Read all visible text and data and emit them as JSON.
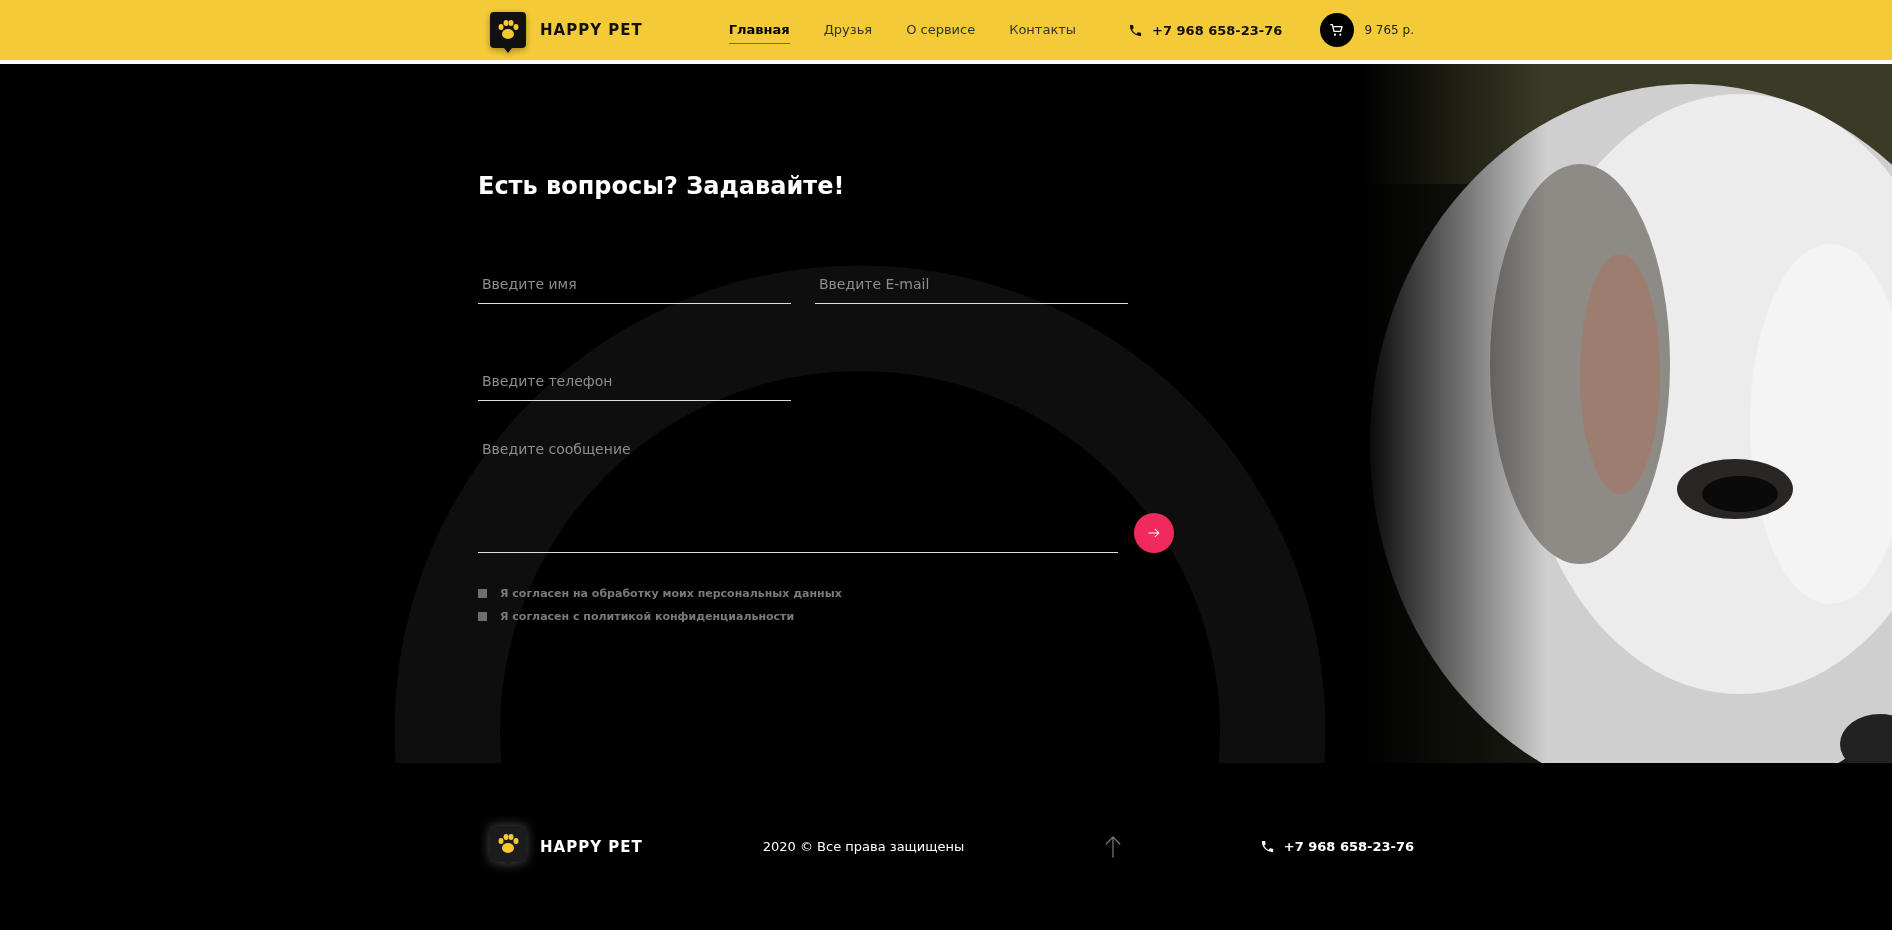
{
  "header": {
    "brand": "HAPPY PET",
    "nav": [
      {
        "label": "Главная",
        "selected": true
      },
      {
        "label": "Друзья",
        "selected": false
      },
      {
        "label": "О сервисе",
        "selected": false
      },
      {
        "label": "Контакты",
        "selected": false
      }
    ],
    "phone": "+7 968 658-23-76",
    "cart_total": "9 765 р."
  },
  "contact_form": {
    "title": "Есть вопросы? Задавайте!",
    "fields": [
      {
        "kind": "input",
        "placeholder": "Введите имя"
      },
      {
        "kind": "input",
        "placeholder": "Введите E-mail"
      },
      {
        "kind": "input",
        "placeholder": "Введите телефон"
      },
      {
        "kind": "textarea",
        "placeholder": "Введите сообщение"
      }
    ],
    "consents": [
      {
        "label": "Я согласен на обработку моих персональных данных",
        "checked": false
      },
      {
        "label": "Я согласен с политикой конфиденциальности",
        "checked": false
      }
    ]
  },
  "footer": {
    "brand": "HAPPY PET",
    "copyright": "2020 © Все права защищены",
    "phone": "+7 968 658-23-76"
  }
}
